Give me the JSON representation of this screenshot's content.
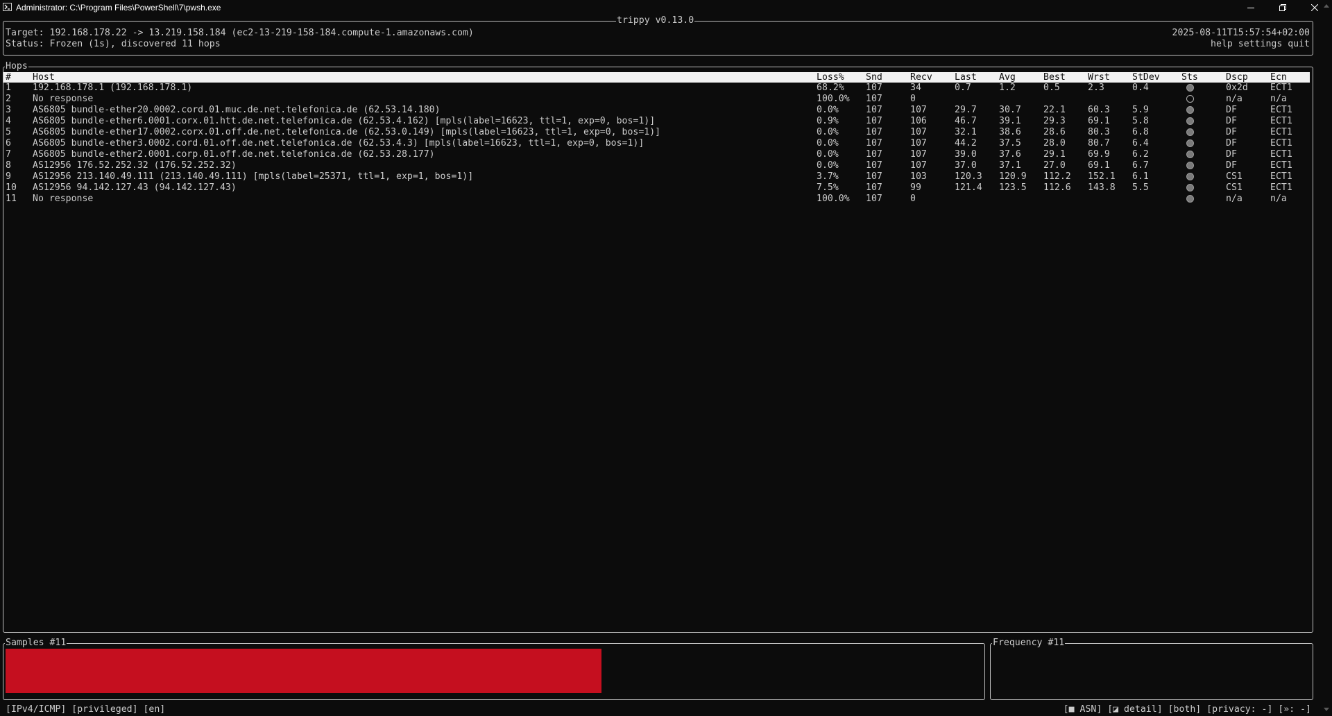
{
  "window": {
    "title": "Administrator: C:\\Program Files\\PowerShell\\7\\pwsh.exe",
    "icon": "powershell-icon"
  },
  "app": {
    "name": "trippy v0.13.0",
    "target": "Target: 192.168.178.22 -> 13.219.158.184 (ec2-13-219-158-184.compute-1.amazonaws.com)",
    "status": "Status: Frozen (1s), discovered 11 hops",
    "timestamp": "2025-08-11T15:57:54+02:00",
    "menu": {
      "help": "help",
      "settings": "settings",
      "quit": "quit"
    }
  },
  "hops": {
    "title": "Hops",
    "columns": [
      "#",
      "Host",
      "Loss%",
      "Snd",
      "Recv",
      "Last",
      "Avg",
      "Best",
      "Wrst",
      "StDev",
      "Sts",
      "Dscp",
      "Ecn"
    ],
    "rows": [
      {
        "n": "1",
        "host": "192.168.178.1 (192.168.178.1)",
        "loss": "68.2%",
        "snd": "107",
        "recv": "34",
        "last": "0.7",
        "avg": "1.2",
        "best": "0.5",
        "wrst": "2.3",
        "stdev": "0.4",
        "sts": "filled",
        "dscp": "0x2d",
        "ecn": "ECT1"
      },
      {
        "n": "2",
        "host": "No response",
        "loss": "100.0%",
        "snd": "107",
        "recv": "0",
        "last": "",
        "avg": "",
        "best": "",
        "wrst": "",
        "stdev": "",
        "sts": "empty",
        "dscp": "n/a",
        "ecn": "n/a"
      },
      {
        "n": "3",
        "host": "AS6805 bundle-ether20.0002.cord.01.muc.de.net.telefonica.de (62.53.14.180)",
        "loss": "0.0%",
        "snd": "107",
        "recv": "107",
        "last": "29.7",
        "avg": "30.7",
        "best": "22.1",
        "wrst": "60.3",
        "stdev": "5.9",
        "sts": "filled",
        "dscp": "DF",
        "ecn": "ECT1"
      },
      {
        "n": "4",
        "host": "AS6805 bundle-ether6.0001.corx.01.htt.de.net.telefonica.de (62.53.4.162) [mpls(label=16623, ttl=1, exp=0, bos=1)]",
        "loss": "0.9%",
        "snd": "107",
        "recv": "106",
        "last": "46.7",
        "avg": "39.1",
        "best": "29.3",
        "wrst": "69.1",
        "stdev": "5.8",
        "sts": "filled",
        "dscp": "DF",
        "ecn": "ECT1"
      },
      {
        "n": "5",
        "host": "AS6805 bundle-ether17.0002.corx.01.off.de.net.telefonica.de (62.53.0.149) [mpls(label=16623, ttl=1, exp=0, bos=1)]",
        "loss": "0.0%",
        "snd": "107",
        "recv": "107",
        "last": "32.1",
        "avg": "38.6",
        "best": "28.6",
        "wrst": "80.3",
        "stdev": "6.8",
        "sts": "filled",
        "dscp": "DF",
        "ecn": "ECT1"
      },
      {
        "n": "6",
        "host": "AS6805 bundle-ether3.0002.cord.01.off.de.net.telefonica.de (62.53.4.3) [mpls(label=16623, ttl=1, exp=0, bos=1)]",
        "loss": "0.0%",
        "snd": "107",
        "recv": "107",
        "last": "44.2",
        "avg": "37.5",
        "best": "28.0",
        "wrst": "80.7",
        "stdev": "6.4",
        "sts": "filled",
        "dscp": "DF",
        "ecn": "ECT1"
      },
      {
        "n": "7",
        "host": "AS6805 bundle-ether2.0001.corp.01.off.de.net.telefonica.de (62.53.28.177)",
        "loss": "0.0%",
        "snd": "107",
        "recv": "107",
        "last": "39.0",
        "avg": "37.6",
        "best": "29.1",
        "wrst": "69.9",
        "stdev": "6.2",
        "sts": "filled",
        "dscp": "DF",
        "ecn": "ECT1"
      },
      {
        "n": "8",
        "host": "AS12956 176.52.252.32 (176.52.252.32)",
        "loss": "0.0%",
        "snd": "107",
        "recv": "107",
        "last": "37.0",
        "avg": "37.1",
        "best": "27.0",
        "wrst": "69.1",
        "stdev": "6.7",
        "sts": "filled",
        "dscp": "DF",
        "ecn": "ECT1"
      },
      {
        "n": "9",
        "host": "AS12956 213.140.49.111 (213.140.49.111) [mpls(label=25371, ttl=1, exp=1, bos=1)]",
        "loss": "3.7%",
        "snd": "107",
        "recv": "103",
        "last": "120.3",
        "avg": "120.9",
        "best": "112.2",
        "wrst": "152.1",
        "stdev": "6.1",
        "sts": "filled",
        "dscp": "CS1",
        "ecn": "ECT1"
      },
      {
        "n": "10",
        "host": "AS12956 94.142.127.43 (94.142.127.43)",
        "loss": "7.5%",
        "snd": "107",
        "recv": "99",
        "last": "121.4",
        "avg": "123.5",
        "best": "112.6",
        "wrst": "143.8",
        "stdev": "5.5",
        "sts": "filled",
        "dscp": "CS1",
        "ecn": "ECT1"
      },
      {
        "n": "11",
        "host": "No response",
        "loss": "100.0%",
        "snd": "107",
        "recv": "0",
        "last": "",
        "avg": "",
        "best": "",
        "wrst": "",
        "stdev": "",
        "sts": "filled",
        "dscp": "n/a",
        "ecn": "n/a"
      }
    ]
  },
  "samples": {
    "title": "Samples #11",
    "bar_fill_fraction": 0.61,
    "bar_color": "#c50f1f"
  },
  "frequency": {
    "title": "Frequency #11"
  },
  "footer": {
    "left": "[IPv4/ICMP] [privileged] [en]",
    "right": "[■ ASN] [◪ detail] [both] [privacy: -] [»: -]"
  },
  "colors": {
    "background": "#0c0c0c",
    "foreground": "#cccccc",
    "header_bg": "#f2f2f2",
    "bar": "#c50f1f"
  }
}
